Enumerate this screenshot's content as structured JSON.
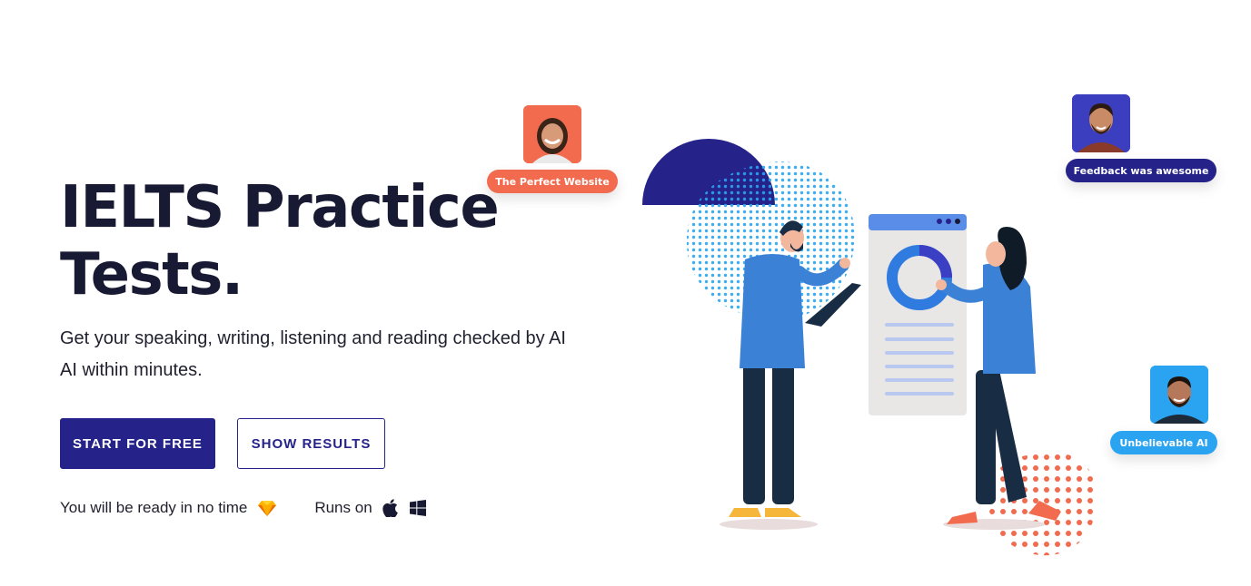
{
  "hero": {
    "title_line1": "IELTS Practice",
    "title_line2": "Tests.",
    "subtitle": "Get your speaking, writing, listening and reading checked by AI AI within minutes."
  },
  "cta": {
    "primary_label": "START FOR FREE",
    "secondary_label": "SHOW RESULTS"
  },
  "meta": {
    "ready_text": "You will be ready in no time",
    "runs_on_text": "Runs on",
    "ready_icon": "diamond-icon",
    "platform_icons": [
      "apple-icon",
      "windows-icon"
    ]
  },
  "testimonials": [
    {
      "label": "The Perfect Website",
      "color": "#f26b4e"
    },
    {
      "label": "Feedback was awesome",
      "color": "#25238a"
    },
    {
      "label": "Unbelievable AI",
      "color": "#2aa4f0"
    }
  ],
  "colors": {
    "brand": "#25238a",
    "orange": "#f26b4e",
    "sky": "#2aa4f0",
    "person_shirt": "#3b82d6",
    "pants": "#182c44"
  }
}
